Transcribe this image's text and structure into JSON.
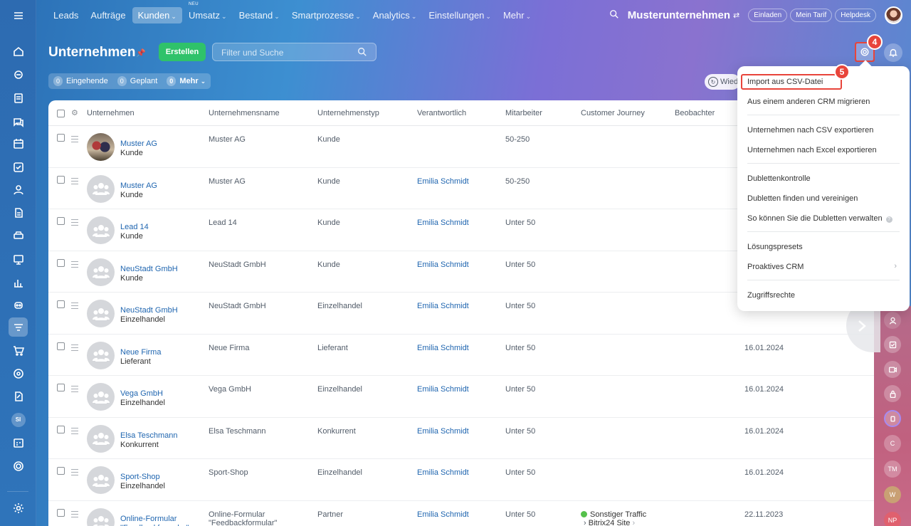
{
  "nav": {
    "items": [
      {
        "label": "Leads",
        "chevron": false
      },
      {
        "label": "Aufträge",
        "chevron": false
      },
      {
        "label": "Kunden",
        "chevron": true,
        "active": true
      },
      {
        "label": "Umsatz",
        "chevron": true,
        "badge": "NEU"
      },
      {
        "label": "Bestand",
        "chevron": true
      },
      {
        "label": "Smartprozesse",
        "chevron": true
      },
      {
        "label": "Analytics",
        "chevron": true
      },
      {
        "label": "Einstellungen",
        "chevron": true
      },
      {
        "label": "Mehr",
        "chevron": true
      }
    ],
    "company": "Musterunternehmen",
    "invite": "Einladen",
    "tariff": "Mein Tarif",
    "helpdesk": "Helpdesk"
  },
  "header": {
    "title": "Unternehmen",
    "create": "Erstellen",
    "search_placeholder": "Filter und Suche"
  },
  "counters": [
    {
      "num": "0",
      "label": "Eingehende"
    },
    {
      "num": "0",
      "label": "Geplant"
    },
    {
      "num": "0",
      "label": "Mehr"
    }
  ],
  "wied_label": "Wied",
  "steps": {
    "gear": "4",
    "import": "5"
  },
  "table": {
    "headers": [
      "Unternehmen",
      "Unternehmensname",
      "Unternehmenstyp",
      "Verantwortlich",
      "Mitarbeiter",
      "Customer Journey",
      "Beobachter"
    ],
    "rows": [
      {
        "name": "Muster AG",
        "type_sub": "Kunde",
        "company": "Muster AG",
        "ctype": "Kunde",
        "owner": "",
        "staff": "50-250",
        "journey": "",
        "journey2": "",
        "date": "",
        "photo": true
      },
      {
        "name": "Muster AG",
        "type_sub": "Kunde",
        "company": "Muster AG",
        "ctype": "Kunde",
        "owner": "Emilia Schmidt",
        "staff": "50-250",
        "journey": "",
        "journey2": "",
        "date": ""
      },
      {
        "name": "Lead 14",
        "type_sub": "Kunde",
        "company": "Lead 14",
        "ctype": "Kunde",
        "owner": "Emilia Schmidt",
        "staff": "Unter 50",
        "journey": "",
        "journey2": "",
        "date": ""
      },
      {
        "name": "NeuStadt GmbH",
        "type_sub": "Kunde",
        "company": "NeuStadt GmbH",
        "ctype": "Kunde",
        "owner": "Emilia Schmidt",
        "staff": "Unter 50",
        "journey": "",
        "journey2": "",
        "date": ""
      },
      {
        "name": "NeuStadt GmbH",
        "type_sub": "Einzelhandel",
        "company": "NeuStadt GmbH",
        "ctype": "Einzelhandel",
        "owner": "Emilia Schmidt",
        "staff": "Unter 50",
        "journey": "",
        "journey2": "",
        "date": ""
      },
      {
        "name": "Neue Firma",
        "type_sub": "Lieferant",
        "company": "Neue Firma",
        "ctype": "Lieferant",
        "owner": "Emilia Schmidt",
        "staff": "Unter 50",
        "journey": "",
        "journey2": "",
        "date": "16.01.2024"
      },
      {
        "name": "Vega GmbH",
        "type_sub": "Einzelhandel",
        "company": "Vega GmbH",
        "ctype": "Einzelhandel",
        "owner": "Emilia Schmidt",
        "staff": "Unter 50",
        "journey": "",
        "journey2": "",
        "date": "16.01.2024"
      },
      {
        "name": "Elsa Teschmann",
        "type_sub": "Konkurrent",
        "company": "Elsa Teschmann",
        "ctype": "Konkurrent",
        "owner": "Emilia Schmidt",
        "staff": "Unter 50",
        "journey": "",
        "journey2": "",
        "date": "16.01.2024"
      },
      {
        "name": "Sport-Shop",
        "type_sub": "Einzelhandel",
        "company": "Sport-Shop",
        "ctype": "Einzelhandel",
        "owner": "Emilia Schmidt",
        "staff": "Unter 50",
        "journey": "",
        "journey2": "",
        "date": "16.01.2024"
      },
      {
        "name": "Online-Formular",
        "type_sub": "\"Feedbackformular\"",
        "company": "Online-Formular",
        "company2": "\"Feedbackformular\"",
        "ctype": "Partner",
        "owner": "Emilia Schmidt",
        "staff": "Unter 50",
        "journey": "Sonstiger Traffic",
        "journey2": "Bitrix24 Site",
        "date": "22.11.2023",
        "name_link2": true
      }
    ]
  },
  "menu": {
    "items": [
      {
        "label": "Import aus CSV-Datei",
        "group": 1
      },
      {
        "label": "Aus einem anderen CRM migrieren",
        "group": 1
      },
      {
        "label": "Unternehmen nach CSV exportieren",
        "group": 2
      },
      {
        "label": "Unternehmen nach Excel exportieren",
        "group": 2
      },
      {
        "label": "Dublettenkontrolle",
        "group": 3
      },
      {
        "label": "Dubletten finden und vereinigen",
        "group": 3
      },
      {
        "label": "So können Sie die Dubletten verwalten",
        "group": 3,
        "help": true
      },
      {
        "label": "Lösungspresets",
        "group": 4
      },
      {
        "label": "Proaktives CRM",
        "group": 4,
        "submenu": true
      },
      {
        "label": "Zugriffsrechte",
        "group": 5
      }
    ]
  },
  "right_strip": [
    "C",
    "TM",
    "W",
    "NP"
  ],
  "sidebar_badge": "SI",
  "colors": {
    "accent": "#2066b0",
    "create": "#2fc26a",
    "highlight": "#e8443a"
  }
}
